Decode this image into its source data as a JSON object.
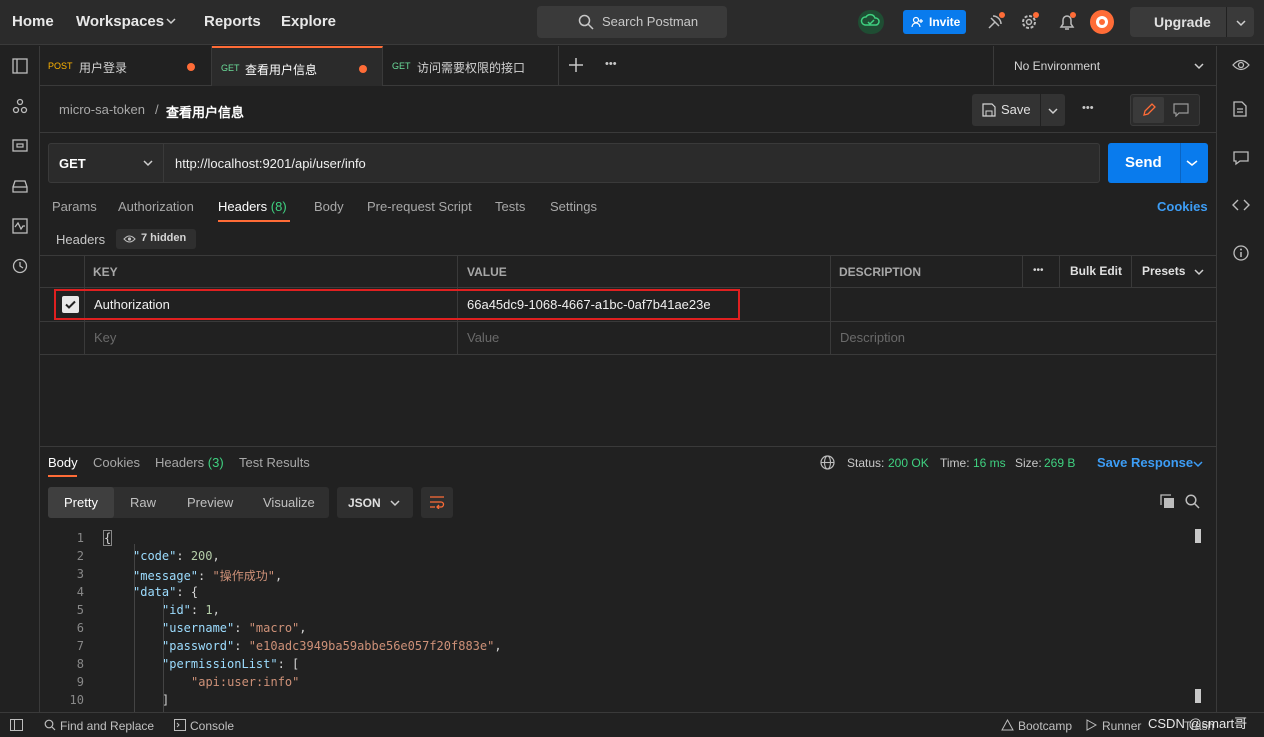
{
  "nav": {
    "home": "Home",
    "workspaces": "Workspaces",
    "reports": "Reports",
    "explore": "Explore",
    "search_placeholder": "Search Postman",
    "invite": "Invite",
    "upgrade": "Upgrade"
  },
  "tabs": [
    {
      "method": "POST",
      "title": "用户登录",
      "method_color": "#ffb400"
    },
    {
      "method": "GET",
      "title": "查看用户信息",
      "method_color": "#6bdd9a"
    },
    {
      "method": "GET",
      "title": "访问需要权限的接口",
      "method_color": "#6bdd9a"
    }
  ],
  "environment": "No Environment",
  "breadcrumb": {
    "collection": "micro-sa-token",
    "sep": "/",
    "request": "查看用户信息"
  },
  "save": "Save",
  "request": {
    "method": "GET",
    "url": "http://localhost:9201/api/user/info",
    "send": "Send"
  },
  "req_tabs": {
    "params": "Params",
    "authorization": "Authorization",
    "headers": "Headers",
    "headers_count": "(8)",
    "body": "Body",
    "prerequest": "Pre-request Script",
    "tests": "Tests",
    "settings": "Settings",
    "cookies": "Cookies"
  },
  "headers_section": {
    "title": "Headers",
    "hidden": "7 hidden"
  },
  "table": {
    "col_key": "KEY",
    "col_value": "VALUE",
    "col_desc": "DESCRIPTION",
    "more": "•••",
    "bulk_edit": "Bulk Edit",
    "presets": "Presets",
    "row": {
      "key": "Authorization",
      "value": "66a45dc9-1068-4667-a1bc-0af7b41ae23e"
    },
    "placeholder": {
      "key": "Key",
      "value": "Value",
      "desc": "Description"
    }
  },
  "resp_tabs": {
    "body": "Body",
    "cookies": "Cookies",
    "headers": "Headers",
    "headers_count": "(3)",
    "test_results": "Test Results"
  },
  "status": {
    "status_label": "Status:",
    "status_value": "200 OK",
    "time_label": "Time:",
    "time_value": "16 ms",
    "size_label": "Size:",
    "size_value": "269 B",
    "save_response": "Save Response"
  },
  "view_tabs": {
    "pretty": "Pretty",
    "raw": "Raw",
    "preview": "Preview",
    "visualize": "Visualize",
    "format": "JSON"
  },
  "code_lines": [
    "1",
    "2",
    "3",
    "4",
    "5",
    "6",
    "7",
    "8",
    "9",
    "10"
  ],
  "json": {
    "l1": "{",
    "code_key": "\"code\"",
    "code_val": "200",
    "message_key": "\"message\"",
    "message_val": "\"操作成功\"",
    "data_key": "\"data\"",
    "data_open": "{",
    "id_key": "\"id\"",
    "id_val": "1",
    "username_key": "\"username\"",
    "username_val": "\"macro\"",
    "password_key": "\"password\"",
    "password_val": "\"e10adc3949ba59abbe56e057f20f883e\"",
    "perm_key": "\"permissionList\"",
    "perm_open": "[",
    "perm_item": "\"api:user:info\"",
    "perm_close": "]"
  },
  "bottom": {
    "find_replace": "Find and Replace",
    "console": "Console",
    "bootcamp": "Bootcamp",
    "runner": "Runner",
    "trash": "Trash",
    "watermark": "CSDN @smart哥"
  }
}
